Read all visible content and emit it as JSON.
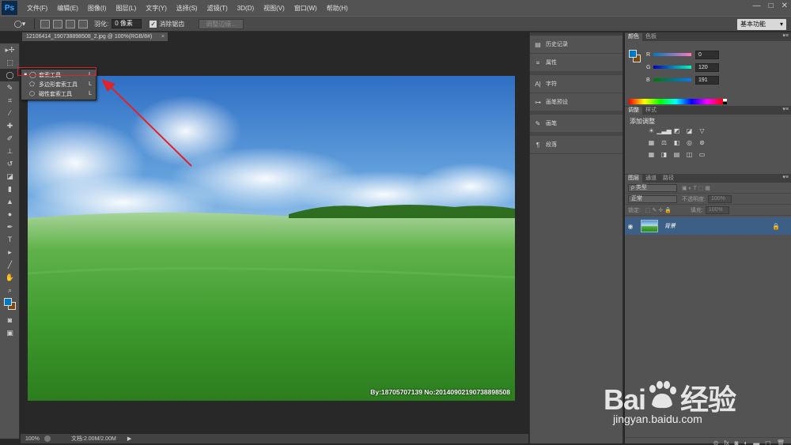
{
  "app": {
    "logo": "Ps"
  },
  "menu": [
    "文件(F)",
    "编辑(E)",
    "图像(I)",
    "图层(L)",
    "文字(Y)",
    "选择(S)",
    "滤镜(T)",
    "3D(D)",
    "视图(V)",
    "窗口(W)",
    "帮助(H)"
  ],
  "window_controls": [
    "—",
    "□",
    "✕"
  ],
  "options": {
    "feather_label": "羽化:",
    "feather_value": "0 像素",
    "antialias_label": "消除锯齿",
    "refine_edge": "调整边缘...",
    "workspace": "基本功能"
  },
  "document": {
    "tab_title": "12106414_190738898508_2.jpg @ 100%(RGB/8#)",
    "close": "×",
    "photo_watermark": "By:18705707139 No:20140902190738898508"
  },
  "status": {
    "zoom": "100%",
    "doc_size": "文档:2.00M/2.00M",
    "arrow": "▶"
  },
  "flyout": [
    {
      "label": "套索工具",
      "key": "L",
      "active": true
    },
    {
      "label": "多边形套索工具",
      "key": "L",
      "active": false
    },
    {
      "label": "磁性套索工具",
      "key": "L",
      "active": false
    }
  ],
  "mid_dock": [
    "历史记录",
    "属性",
    "字符",
    "画笔预设",
    "画笔",
    "段落"
  ],
  "color_panel": {
    "tabs": [
      "颜色",
      "色板"
    ],
    "r": {
      "label": "R",
      "value": "0"
    },
    "g": {
      "label": "G",
      "value": "120"
    },
    "b": {
      "label": "B",
      "value": "191"
    },
    "fg_color": "#0078BF",
    "bg_color": "#7A4A14"
  },
  "adjust_panel": {
    "tabs": [
      "调整",
      "样式"
    ],
    "title": "添加调整"
  },
  "layers_panel": {
    "tabs": [
      "图层",
      "通道",
      "路径"
    ],
    "filter": "ρ 类型",
    "blend": "正常",
    "opacity_label": "不透明度:",
    "opacity": "100%",
    "lock_label": "锁定:",
    "fill_label": "填充:",
    "fill": "100%",
    "layer_name": "背景"
  },
  "baidu": {
    "logo_left": "Bai",
    "logo_right": "经验",
    "url": "jingyan.baidu.com"
  }
}
